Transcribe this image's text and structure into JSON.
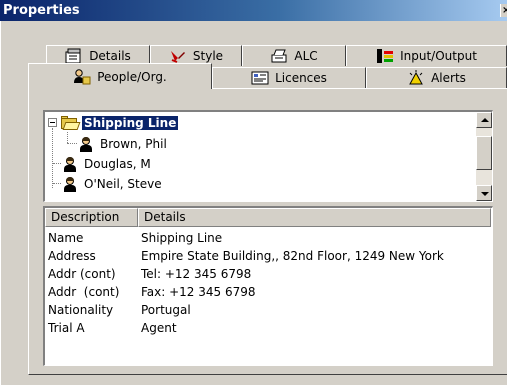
{
  "window": {
    "title": "Properties",
    "close_glyph": "×"
  },
  "tabs_row1": [
    {
      "label": "Details",
      "icon": "details-icon"
    },
    {
      "label": "Style",
      "icon": "style-icon"
    },
    {
      "label": "ALC",
      "icon": "alc-icon"
    },
    {
      "label": "Input/Output",
      "icon": "input-output-icon"
    }
  ],
  "tabs_row2": [
    {
      "label": "People/Org.",
      "icon": "people-org-icon",
      "active": true
    },
    {
      "label": "Licences",
      "icon": "licences-icon"
    },
    {
      "label": "Alerts",
      "icon": "alerts-icon"
    }
  ],
  "tree": {
    "items": [
      {
        "label": "Shipping Line",
        "selected": true,
        "expanded": true
      },
      {
        "label": "Brown, Phil"
      },
      {
        "label": "Douglas, M"
      },
      {
        "label": "O'Neil, Steve"
      }
    ]
  },
  "grid": {
    "columns": [
      "Description",
      "Details"
    ],
    "rows": [
      [
        "Name",
        "Shipping Line"
      ],
      [
        "Address",
        "Empire State Building,, 82nd Floor, 1249 New York"
      ],
      [
        "Addr (cont)",
        "Tel: +12 345 6798"
      ],
      [
        "Addr  (cont)",
        "Fax: +12 345 6798"
      ],
      [
        "Nationality",
        "Portugal"
      ],
      [
        "Trial A",
        "Agent"
      ]
    ]
  },
  "colors": {
    "titlebar_start": "#0a246a",
    "titlebar_end": "#a6caf0",
    "selection": "#0a246a",
    "face": "#d4d0c8"
  }
}
